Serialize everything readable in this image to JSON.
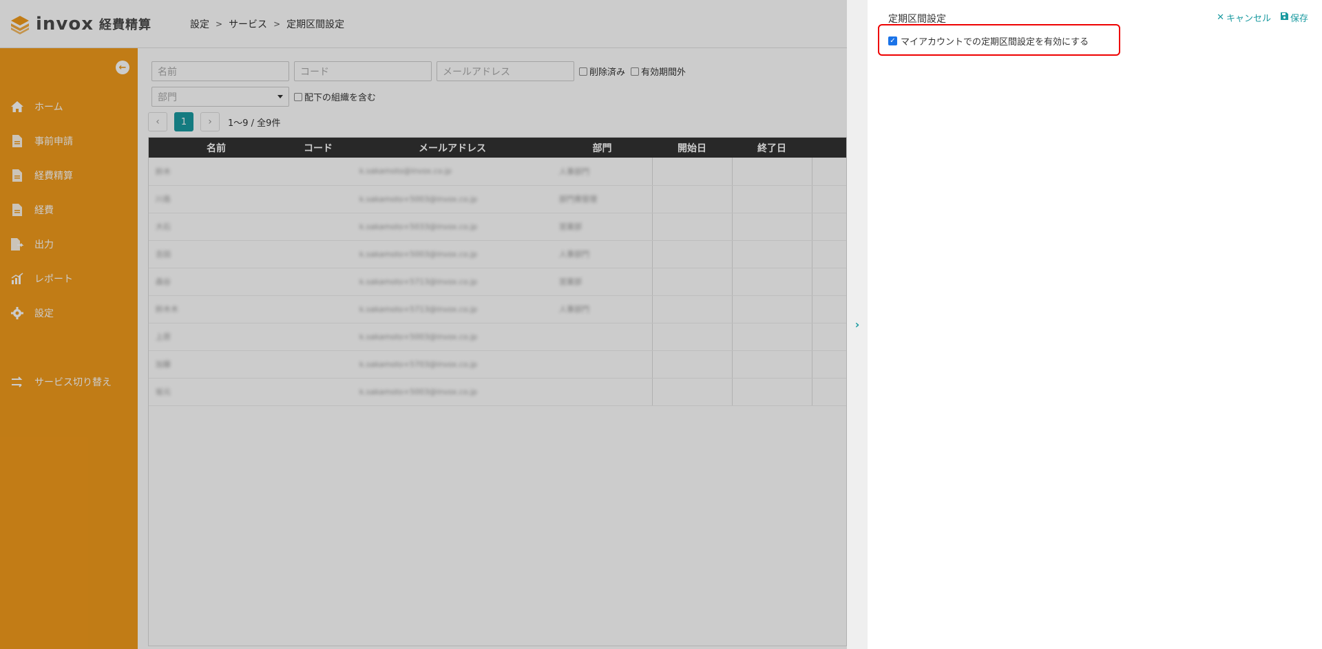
{
  "header": {
    "logo_text": "invox",
    "logo_sub": "経費精算",
    "breadcrumb": [
      "設定",
      "サービス",
      "定期区間設定"
    ]
  },
  "sidebar": {
    "items": [
      {
        "label": "ホーム",
        "icon": "home-icon"
      },
      {
        "label": "事前申請",
        "icon": "document-icon"
      },
      {
        "label": "経費精算",
        "icon": "document-icon"
      },
      {
        "label": "経費",
        "icon": "document-icon"
      },
      {
        "label": "出力",
        "icon": "export-icon"
      },
      {
        "label": "レポート",
        "icon": "chart-icon"
      },
      {
        "label": "設定",
        "icon": "gear-icon"
      }
    ],
    "switch_label": "サービス切り替え"
  },
  "filters": {
    "name_placeholder": "名前",
    "code_placeholder": "コード",
    "email_placeholder": "メールアドレス",
    "deleted_label": "削除済み",
    "outside_period_label": "有効期間外",
    "department_placeholder": "部門",
    "include_sub_label": "配下の組織を含む"
  },
  "pager": {
    "current_page": "1",
    "info": "1〜9 / 全9件"
  },
  "table": {
    "headers": [
      "名前",
      "コード",
      "メールアドレス",
      "部門",
      "開始日",
      "終了日"
    ],
    "rows": [
      {
        "name": "鈴木",
        "email": "k.sakamoto@invox.co.jp",
        "dept": "人事部門"
      },
      {
        "name": "川島",
        "email": "k.sakamoto+5003@invox.co.jp",
        "dept": "部門費管理"
      },
      {
        "name": "大石",
        "email": "k.sakamoto+5033@invox.co.jp",
        "dept": "営業部"
      },
      {
        "name": "吉田",
        "email": "k.sakamoto+5003@invox.co.jp",
        "dept": "人事部門"
      },
      {
        "name": "森谷",
        "email": "k.sakamoto+5713@invox.co.jp",
        "dept": "営業部"
      },
      {
        "name": "鈴木木",
        "email": "k.sakamoto+5713@invox.co.jp",
        "dept": "人事部門"
      },
      {
        "name": "上原",
        "email": "k.sakamoto+5003@invox.co.jp",
        "dept": ""
      },
      {
        "name": "加藤",
        "email": "k.sakamoto+5703@invox.co.jp",
        "dept": ""
      },
      {
        "name": "坂元",
        "email": "k.sakamoto+5003@invox.co.jp",
        "dept": ""
      }
    ]
  },
  "drawer": {
    "title": "定期区間設定",
    "cancel_label": "キャンセル",
    "save_label": "保存",
    "enable_label": "マイアカウントでの定期区間設定を有効にする",
    "enable_checked": true
  },
  "colors": {
    "sidebar": "#f29b1c",
    "accent": "#1a9aa0",
    "highlight": "#e00000"
  }
}
